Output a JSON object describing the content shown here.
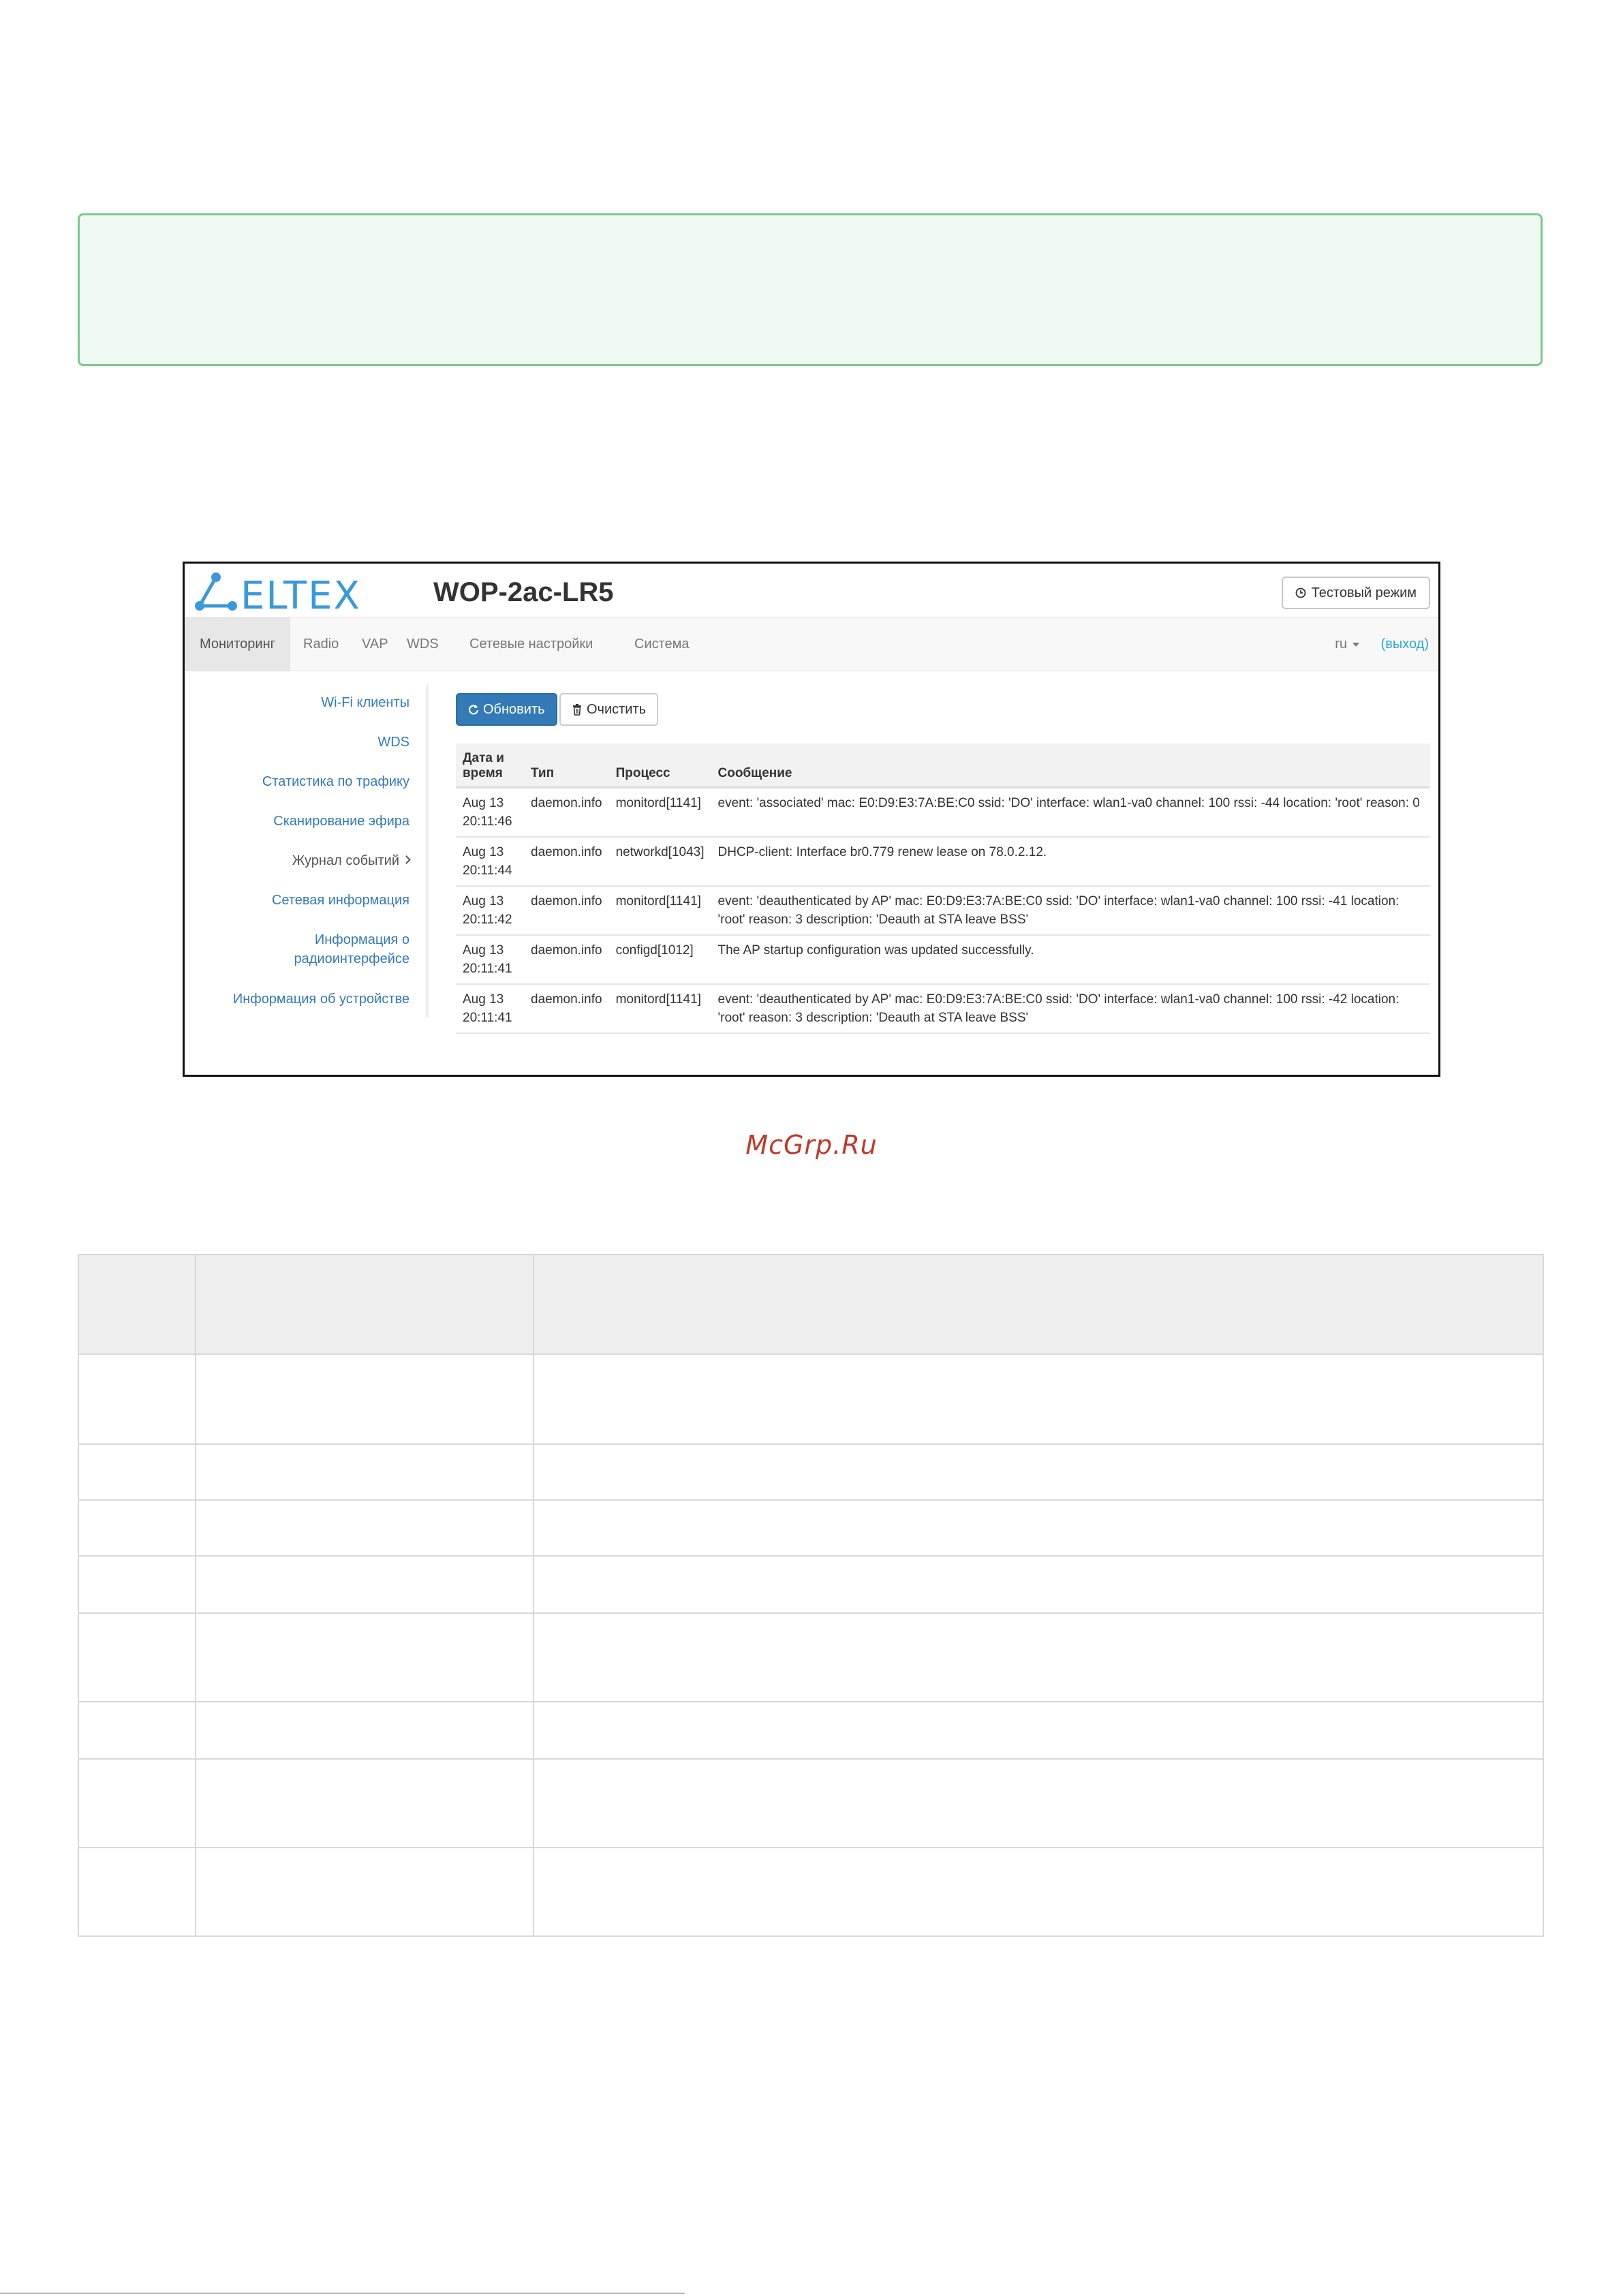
{
  "app": {
    "brand": "ELTEX",
    "device_title": "WOP-2ac-LR5",
    "test_mode_label": "Тестовый режим"
  },
  "nav": {
    "items": [
      "Мониторинг",
      "Radio",
      "VAP",
      "WDS",
      "Сетевые настройки",
      "Система"
    ],
    "active": "Мониторинг",
    "lang": "ru",
    "logout": "(выход)"
  },
  "sidebar": {
    "items": [
      "Wi-Fi клиенты",
      "WDS",
      "Статистика по трафику",
      "Сканирование эфира",
      "Журнал событий",
      "Сетевая информация",
      "Информация о радиоинтерфейсе",
      "Информация об устройстве"
    ],
    "current": "Журнал событий"
  },
  "toolbar": {
    "refresh_label": "Обновить",
    "clear_label": "Очистить"
  },
  "log_table": {
    "headers": [
      "Дата и время",
      "Тип",
      "Процесс",
      "Сообщение"
    ],
    "rows": [
      {
        "date": "Aug 13",
        "time": "20:11:46",
        "type": "daemon.info",
        "process": "monitord[1141]",
        "message": "event: 'associated' mac: E0:D9:E3:7A:BE:C0 ssid: 'DO' interface: wlan1-va0 channel: 100 rssi: -44 location: 'root' reason: 0"
      },
      {
        "date": "Aug 13",
        "time": "20:11:44",
        "type": "daemon.info",
        "process": "networkd[1043]",
        "message": "DHCP-client: Interface br0.779 renew lease on 78.0.2.12."
      },
      {
        "date": "Aug 13",
        "time": "20:11:42",
        "type": "daemon.info",
        "process": "monitord[1141]",
        "message": "event: 'deauthenticated by AP' mac: E0:D9:E3:7A:BE:C0 ssid: 'DO' interface: wlan1-va0 channel: 100 rssi: -41 location: 'root' reason: 3 description: 'Deauth at STA leave BSS'"
      },
      {
        "date": "Aug 13",
        "time": "20:11:41",
        "type": "daemon.info",
        "process": "configd[1012]",
        "message": "The AP startup configuration was updated successfully."
      },
      {
        "date": "Aug 13",
        "time": "20:11:41",
        "type": "daemon.info",
        "process": "monitord[1141]",
        "message": "event: 'deauthenticated by AP' mac: E0:D9:E3:7A:BE:C0 ssid: 'DO' interface: wlan1-va0 channel: 100 rssi: -42 location: 'root' reason: 3 description: 'Deauth at STA leave BSS'"
      }
    ]
  },
  "watermark": "McGrp.Ru",
  "icons": {
    "clock": "clock-icon",
    "refresh": "refresh-icon",
    "trash": "trash-icon",
    "caret": "caret-down-icon",
    "chevron": "chevron-right-icon"
  },
  "colors": {
    "brand_blue": "#3a9ad9",
    "primary_button": "#337ab7",
    "link": "#337ab7",
    "logout_link": "#2aa9d9",
    "notice_border": "#7cc98a",
    "watermark": "#c0392b"
  }
}
